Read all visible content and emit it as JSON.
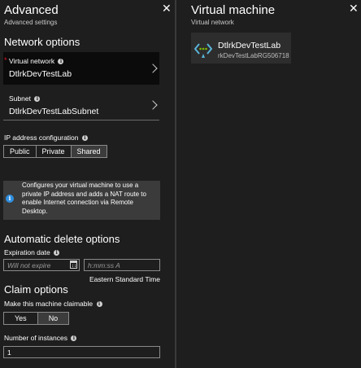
{
  "left_blade": {
    "title": "Advanced",
    "subtitle": "Advanced settings",
    "close_glyph": "✕",
    "network_options": {
      "heading": "Network options",
      "virtual_network": {
        "label": "Virtual network",
        "value": "DtlrkDevTestLab",
        "required": true
      },
      "subnet": {
        "label": "Subnet",
        "value": "DtlrkDevTestLabSubnet"
      }
    },
    "ip_config": {
      "label": "IP address configuration",
      "options": [
        "Public",
        "Private",
        "Shared"
      ],
      "selected": "Shared"
    },
    "info_box": {
      "icon": "info-icon",
      "text": "Configures your virtual machine to use a private IP address and adds a NAT route to enable Internet connection via Remote Desktop."
    },
    "auto_delete": {
      "heading": "Automatic delete options",
      "expiration_label": "Expiration date",
      "date_placeholder": "Will not expire",
      "time_placeholder": "h:mm:ss A",
      "timezone": "Eastern Standard Time"
    },
    "claim": {
      "heading": "Claim options",
      "claimable_label": "Make this machine claimable",
      "options": [
        "Yes",
        "No"
      ],
      "selected": "No"
    },
    "instances": {
      "label": "Number of instances",
      "value": "1"
    }
  },
  "right_blade": {
    "title": "Virtual machine",
    "subtitle": "Virtual network",
    "close_glyph": "✕",
    "tile": {
      "icon": "virtual-network-icon",
      "name": "DtlrkDevTestLab",
      "resource_group": "rkDevTestLabRG506718"
    }
  },
  "colors": {
    "background": "#1e1e1e",
    "accent": "#2f8fe0",
    "required": "#e81123",
    "info_box": "#3b3b3b"
  },
  "info_glyph": "i"
}
